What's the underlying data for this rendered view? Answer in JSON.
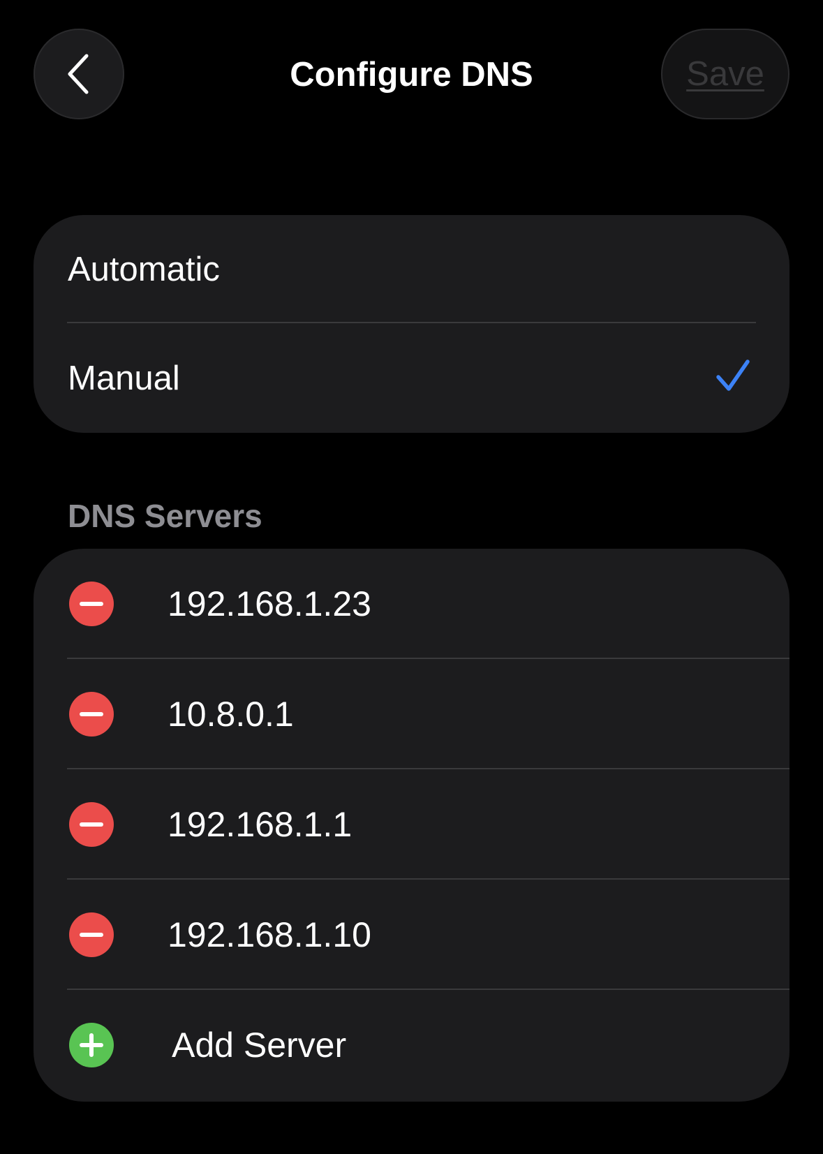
{
  "header": {
    "title": "Configure DNS",
    "save_label": "Save",
    "back_icon": "chevron-left-icon"
  },
  "mode": {
    "options": [
      {
        "label": "Automatic",
        "selected": false
      },
      {
        "label": "Manual",
        "selected": true
      }
    ],
    "check_icon": "checkmark-icon"
  },
  "servers": {
    "section_title": "DNS Servers",
    "items": [
      {
        "address": "192.168.1.23"
      },
      {
        "address": "10.8.0.1"
      },
      {
        "address": "192.168.1.1"
      },
      {
        "address": "192.168.1.10"
      }
    ],
    "add_label": "Add Server"
  },
  "colors": {
    "background": "#000000",
    "card": "#1c1c1e",
    "accent_blue": "#3c82f6",
    "remove_red": "#eb4d4b",
    "add_green": "#59c453",
    "secondary_text": "#8e8e93",
    "disabled_text": "#39393b"
  }
}
